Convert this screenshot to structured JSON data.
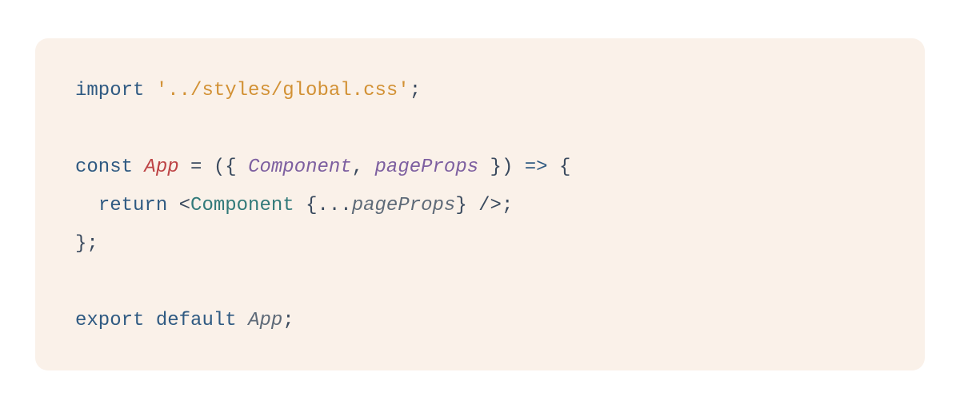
{
  "code": {
    "line1": {
      "import_kw": "import",
      "space": " ",
      "string": "'../styles/global.css'",
      "semi": ";"
    },
    "blank1": "",
    "line3": {
      "const_kw": "const",
      "sp1": " ",
      "fn_name": "App",
      "sp2": " ",
      "eq": "=",
      "sp3": " ",
      "open": "({ ",
      "param1": "Component",
      "comma": ", ",
      "param2": "pageProps",
      "close": " })",
      "sp4": " ",
      "arrow": "=>",
      "sp5": " ",
      "brace": "{"
    },
    "line4": {
      "indent": "  ",
      "return_kw": "return",
      "sp1": " ",
      "lt": "<",
      "tag": "Component",
      "sp2": " ",
      "spread_open": "{",
      "spread_dots": "...",
      "spread_prop": "pageProps",
      "spread_close": "}",
      "sp3": " ",
      "selfclose": "/>",
      "semi": ";"
    },
    "line5": {
      "close": "};"
    },
    "blank2": "",
    "line7": {
      "export_kw": "export",
      "sp1": " ",
      "default_kw": "default",
      "sp2": " ",
      "id": "App",
      "semi": ";"
    }
  }
}
